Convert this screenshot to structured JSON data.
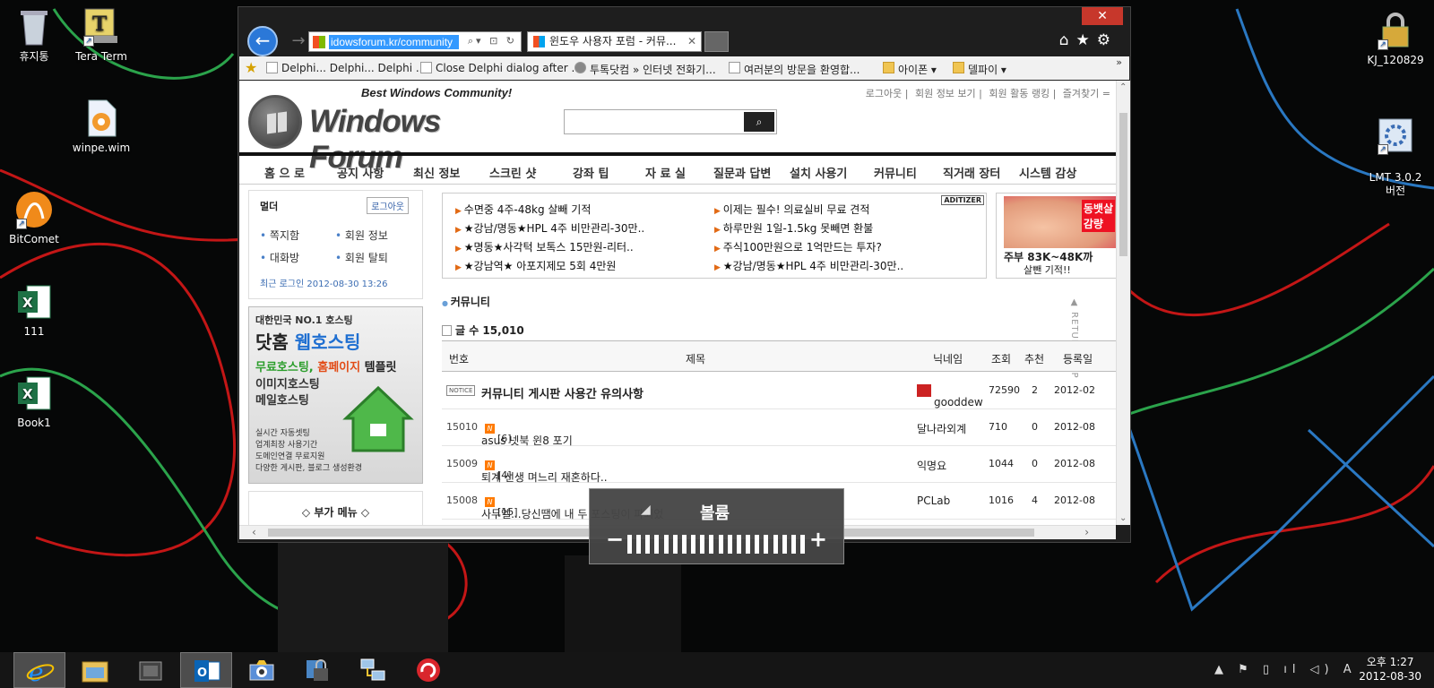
{
  "desktop": {
    "icons": [
      {
        "label": "휴지통",
        "icon": "recycle-bin-icon"
      },
      {
        "label": "Tera Term",
        "icon": "tera-term-icon"
      },
      {
        "label": "winpe.wim",
        "icon": "file-icon"
      },
      {
        "label": "BitComet",
        "icon": "bitcomet-icon"
      },
      {
        "label": "111",
        "icon": "excel-icon"
      },
      {
        "label": "Book1",
        "icon": "excel-icon"
      },
      {
        "label": "KJ_120829",
        "icon": "secure-folder-icon"
      },
      {
        "label": "LMT 3.0.2\n버전",
        "icon": "settings-app-icon"
      }
    ]
  },
  "browser": {
    "close": "✕",
    "back": "←",
    "forward": "→",
    "address": "idowsforum.kr/community",
    "tab_title": "윈도우 사용자 포럼 - 커뮤...",
    "tab_close": "✕",
    "toolbar_icons": [
      "home-icon",
      "favorites-star-icon",
      "gear-icon"
    ],
    "toolbar_glyphs": "⌂★⚙",
    "favorites": [
      {
        "label": "Delphi... Delphi... Delphi ...",
        "type": "page"
      },
      {
        "label": "Close Delphi dialog after ...",
        "type": "page"
      },
      {
        "label": "투톡닷컴 » 인터넷 전화기...",
        "type": "wordpress"
      },
      {
        "label": "여러분의 방문을 환영합...",
        "type": "page"
      },
      {
        "label": "아이폰 ▾",
        "type": "folder"
      },
      {
        "label": "델파이 ▾",
        "type": "folder"
      }
    ],
    "favbar_more": "»"
  },
  "site": {
    "tagline": "Best Windows Community!",
    "name": "Windows Forum",
    "search_placeholder": "",
    "search_icon": "search-icon",
    "top_links": [
      "로그아웃",
      "회원 정보 보기",
      "회원 활동 랭킹",
      "즐겨찾기 ="
    ],
    "nav": [
      "홈 으 로",
      "공지 사항",
      "최신 정보",
      "스크린 샷",
      "강좌 팁",
      "자 료 실",
      "질문과 답변",
      "설치 사용기",
      "커뮤니티",
      "직거래 장터",
      "시스템 감상"
    ],
    "login": {
      "user": "멀더",
      "logout": "로그아웃",
      "menu": [
        "쪽지함",
        "회원 정보",
        "대화방",
        "회원 탈퇴"
      ],
      "last_login": "최근 로그인 2012-08-30 13:26"
    },
    "banner": {
      "line1": "대한민국 NO.1 호스팅",
      "line2a": "닷홈 ",
      "line2b": "웹호스팅",
      "line3a": "무료호스팅, ",
      "line3b": "홈페이지",
      "line3c": " 템플릿",
      "line4": "이미지호스팅\n메일호스팅",
      "line5": "실시간 자동셋팅\n업계최장 사용기간\n도메인연결 무료지원\n다양한 게시판, 블로그 생성환경"
    },
    "submenu": "◇ 부가 메뉴 ◇",
    "ads": [
      "수면중 4주-48kg 살빼 기적",
      "★강남/명동★HPL 4주 비만관리-30만..",
      "★명동★사각턱 보톡스 15만원-리터..",
      "★강남역★ 아포지제모 5회 4만원",
      "이제는 필수! 의료실비 무료 견적",
      "하루만원 1일-1.5kg 못빼면 환불",
      "주식100만원으로 1억만드는 투자?",
      "★강남/명동★HPL 4주 비만관리-30만.."
    ],
    "aditz": "ADITIZER",
    "side_ad": {
      "badge": "동뱃살\n감량",
      "caption1": "주부 83K~48K까",
      "caption2": "살뺀 기적!!"
    },
    "section_title": "커뮤니티",
    "post_count": "글 수 15,010",
    "columns": [
      "번호",
      "제목",
      "닉네임",
      "조회",
      "추천",
      "등록일"
    ],
    "rows": [
      {
        "num": "NOTICE",
        "title": "커뮤니티 게시판 사용간 유의사항",
        "new": "",
        "comments": "",
        "nick": "gooddew",
        "views": "72590",
        "rec": "2",
        "date": "2012-02"
      },
      {
        "num": "15010",
        "title": "asus 넷북 윈8 포기",
        "new": "N",
        "comments": "[6]",
        "nick": "달나라외계",
        "views": "710",
        "rec": "0",
        "date": "2012-08"
      },
      {
        "num": "15009",
        "title": "퇴계 선생 며느리 재혼하다..",
        "new": "N",
        "comments": "[4]",
        "nick": "익명요",
        "views": "1044",
        "rec": "0",
        "date": "2012-08"
      },
      {
        "num": "15008",
        "title": "사무엘...당신땜에 내 두 포스팅이 파되었",
        "new": "N",
        "comments": "[15]",
        "nick": "PCLab",
        "views": "1016",
        "rec": "4",
        "date": "2012-08"
      }
    ],
    "return_top": "▲ RETURN TOP"
  },
  "volume": {
    "label": "볼륨",
    "minus": "−",
    "plus": "+",
    "level_fraction": 1.0,
    "ticks": 20
  },
  "taskbar": {
    "apps": [
      "internet-explorer-icon",
      "file-explorer-icon",
      "folder-app-icon",
      "outlook-icon",
      "camera-app-icon",
      "security-app-icon",
      "network-app-icon",
      "red-swirl-app-icon"
    ],
    "tray_glyphs": "▲ ⚑ ▯ ıl ◁) A",
    "time": "오후 1:27",
    "date": "2012-08-30"
  }
}
